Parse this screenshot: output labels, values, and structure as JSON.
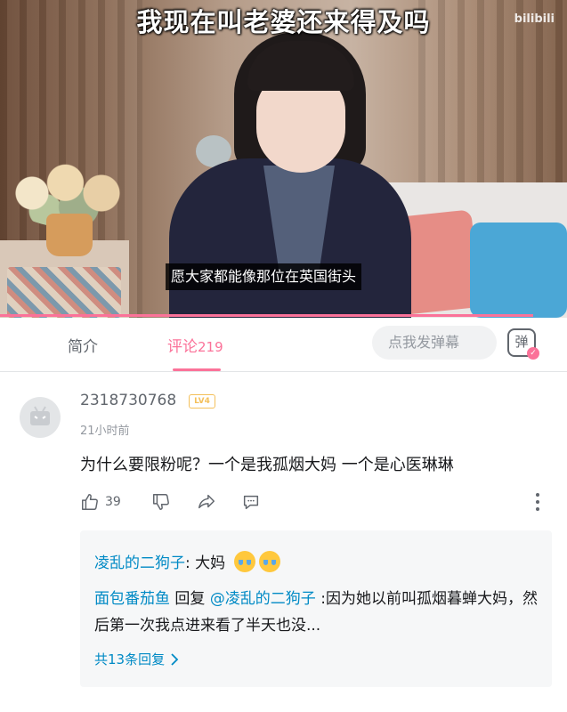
{
  "video": {
    "top_caption": "我现在叫老婆还来得及吗",
    "watermark": "bilibili",
    "subtitle": "愿大家都能像那位在英国街头",
    "progress_fraction": 0.94
  },
  "tabs": {
    "intro": "简介",
    "comments_label": "评论",
    "comments_count": "219",
    "danmaku_placeholder": "点我发弹幕",
    "danmaku_icon_glyph": "弹"
  },
  "comment": {
    "username": "2318730768",
    "level": "LV4",
    "time": "21小时前",
    "text": "为什么要限粉呢？一个是我孤烟大妈  一个是心医琳琳",
    "likes": "39"
  },
  "replies": {
    "reply1": {
      "user": "凌乱的二狗子",
      "text": ": 大妈"
    },
    "reply2": {
      "user": "面包番茄鱼",
      "reply_word": " 回复 ",
      "mention": "@凌乱的二狗子",
      "text": " :因为她以前叫孤烟暮蝉大妈，然后第一次我点进来看了半天也没..."
    },
    "more_label": "共13条回复"
  },
  "colors": {
    "accent": "#fb7299",
    "link": "#008ac5",
    "text_secondary": "#61666d",
    "text_muted": "#9499a0",
    "level_badge": "#f4c05b"
  }
}
